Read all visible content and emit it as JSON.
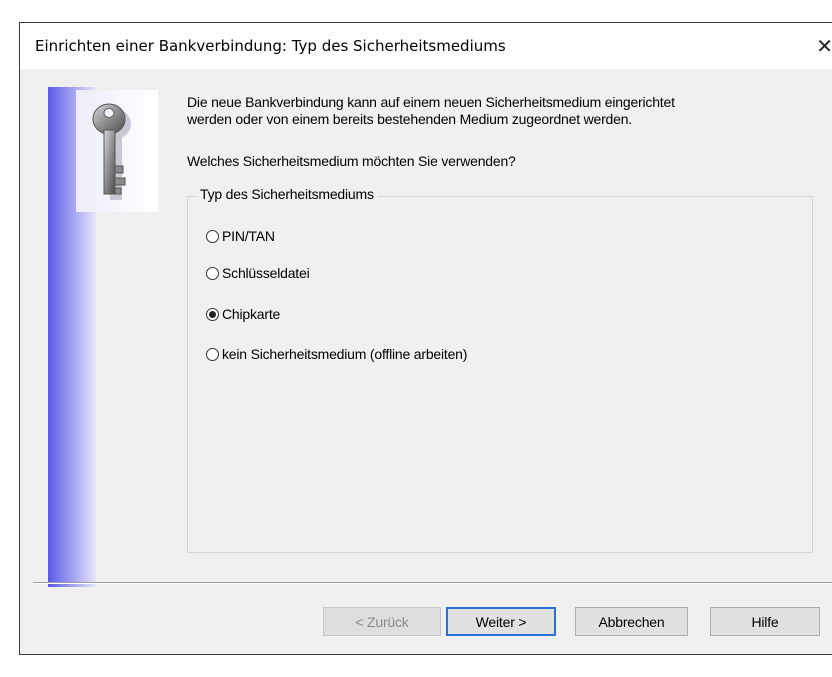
{
  "dialog": {
    "title": "Einrichten einer Bankverbindung: Typ des Sicherheitsmediums",
    "close_glyph": "✕"
  },
  "content": {
    "instruction_line1": "Die neue Bankverbindung kann auf einem neuen Sicherheitsmedium eingerichtet",
    "instruction_line2": "werden oder von einem bereits bestehenden Medium zugeordnet werden.",
    "question": "Welches Sicherheitsmedium möchten Sie verwenden?",
    "group_label": "Typ des Sicherheitsmediums",
    "options": [
      {
        "label": "PIN/TAN",
        "checked": false
      },
      {
        "label": "Schlüsseldatei",
        "checked": false
      },
      {
        "label": "Chipkarte",
        "checked": true
      },
      {
        "label": "kein Sicherheitsmedium (offline arbeiten)",
        "checked": false
      }
    ],
    "icon": "key-icon"
  },
  "buttons": {
    "back": "< Zurück",
    "next": "Weiter >",
    "cancel": "Abbrechen",
    "help": "Hilfe"
  },
  "colors": {
    "banner_accent": "#5a5ae8",
    "default_button_border": "#2a73d6"
  }
}
